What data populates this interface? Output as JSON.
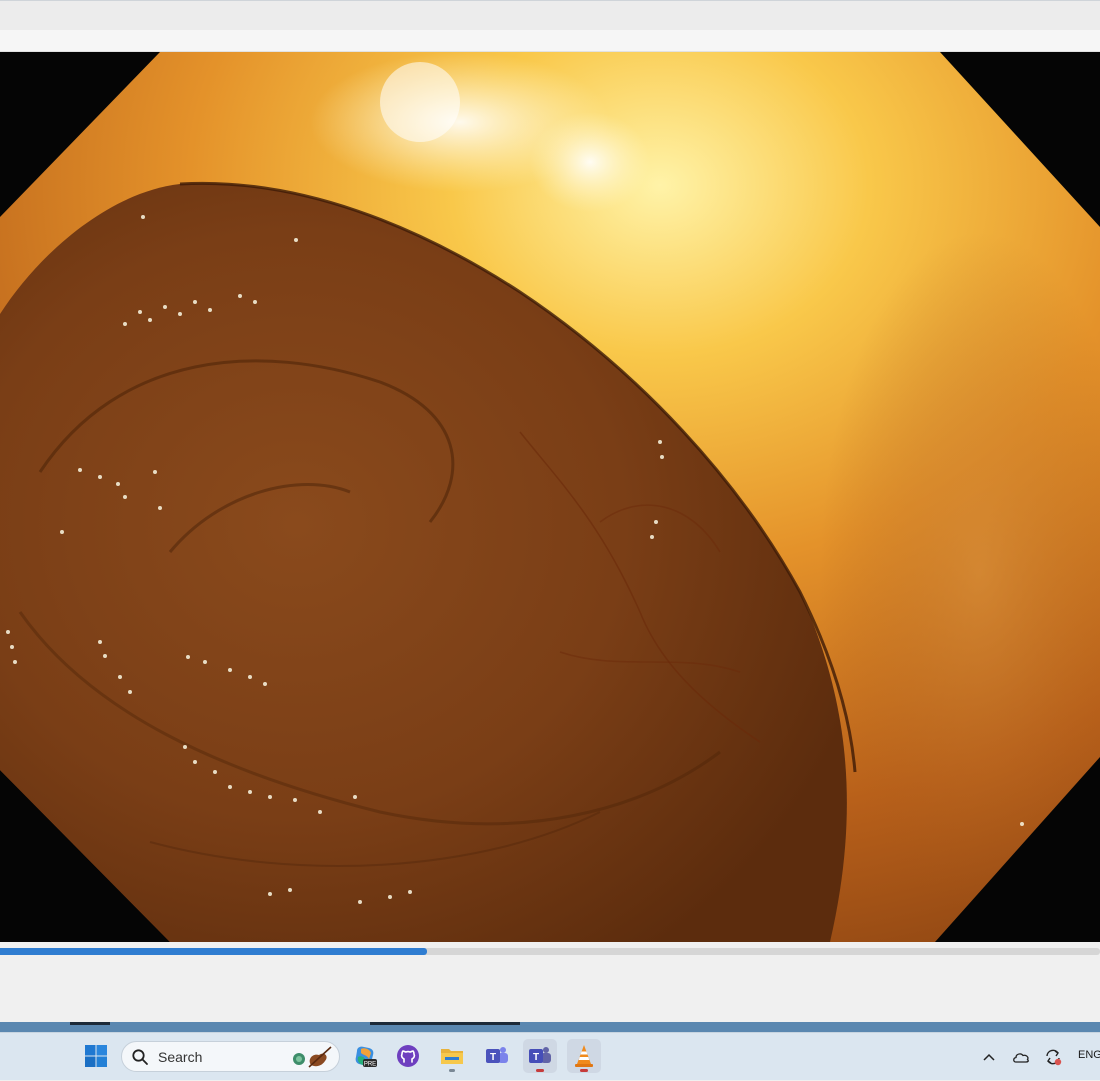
{
  "player": {
    "playback_progress_percent": 38.8
  },
  "taskbar": {
    "search": {
      "placeholder": "Search"
    },
    "pinned_apps": [
      {
        "name": "start-menu-button",
        "icon": "windows-logo-icon"
      },
      {
        "name": "copilot-app",
        "icon": "copilot-pre-icon",
        "badge": "PRE"
      },
      {
        "name": "github-app",
        "icon": "github-icon"
      },
      {
        "name": "file-explorer-app",
        "icon": "folder-icon"
      },
      {
        "name": "teams-classic-app",
        "icon": "teams-icon"
      },
      {
        "name": "teams-app",
        "icon": "teams-icon"
      },
      {
        "name": "vlc-app",
        "icon": "vlc-cone-icon"
      }
    ],
    "tray": {
      "language": "ENG",
      "icons": [
        "chevron-up-icon",
        "onedrive-cloud-icon",
        "sync-icon"
      ]
    }
  },
  "colors": {
    "seek_fill": "#2f7dd1",
    "taskbar_bg": "#dbe6f0",
    "accent_red": "#c63b3b"
  }
}
